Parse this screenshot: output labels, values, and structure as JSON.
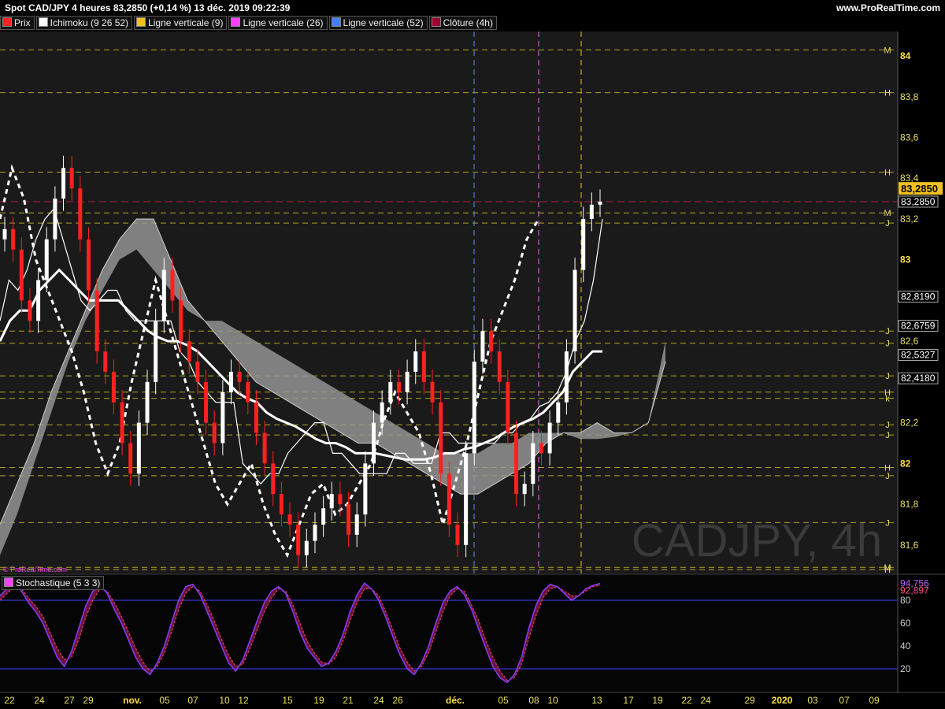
{
  "header": {
    "title": "Spot CAD/JPY 4 heures 83,2850 (+0,14 %) 13 déc. 2019 09:22:39",
    "site": "www.ProRealTime.com"
  },
  "legend": [
    {
      "label": "Prix",
      "color": "#ff2020"
    },
    {
      "label": "Ichimoku (9 26 52)",
      "color": "#ffffff"
    },
    {
      "label": "Ligne verticale (9)",
      "color": "#f0c020"
    },
    {
      "label": "Ligne verticale (26)",
      "color": "#ff40ff"
    },
    {
      "label": "Ligne verticale (52)",
      "color": "#4080ff"
    },
    {
      "label": "Clôture (4h)",
      "color": "#a00030"
    }
  ],
  "watermark": "CADJPY, 4h",
  "copyright": "© ProRealTime.com",
  "stoch_label": "Stochastique (5 3 3)",
  "colors": {
    "price_up": "#ffffff",
    "price_down": "#ff2020",
    "guide_yellow": "#c8c020",
    "stoch_k": "#8040ff",
    "stoch_d": "#ff4070",
    "stoch_band": "#4040ff",
    "current_price_bg": "#f0c020"
  },
  "chart_data": [
    {
      "type": "line",
      "x_ticks": [
        "22",
        "24",
        "27",
        "29",
        "nov.",
        "05",
        "07",
        "10",
        "12",
        "15",
        "19",
        "21",
        "24",
        "26",
        "déc.",
        "05",
        "08",
        "10",
        "13",
        "17",
        "19",
        "22",
        "24",
        "29",
        "2020",
        "03",
        "07",
        "09"
      ],
      "y_ticks": [
        "81,6",
        "81,8",
        "82",
        "82,2",
        "82,6",
        "83",
        "83,2",
        "83,4",
        "83,6",
        "83,8",
        "84"
      ],
      "ylim": [
        81.46,
        84.12
      ],
      "current_price": "83,2850",
      "value_labels": [
        {
          "text": "83,2850",
          "value": 83.285
        },
        {
          "text": "82,8190",
          "value": 82.819
        },
        {
          "text": "82,6759",
          "value": 82.676
        },
        {
          "text": "82,5327",
          "value": 82.533
        },
        {
          "text": "82,4180",
          "value": 82.418
        }
      ],
      "pivot_levels": [
        {
          "letter": "M",
          "value": 84.03
        },
        {
          "letter": "H",
          "value": 83.82
        },
        {
          "letter": "H",
          "value": 83.43
        },
        {
          "letter": "M",
          "value": 83.23
        },
        {
          "letter": "J",
          "value": 83.18
        },
        {
          "letter": "J",
          "value": 82.65
        },
        {
          "letter": "J",
          "value": 82.59
        },
        {
          "letter": "J",
          "value": 82.43
        },
        {
          "letter": "k",
          "value": 82.32
        },
        {
          "letter": "H",
          "value": 82.35
        },
        {
          "letter": "J",
          "value": 82.19
        },
        {
          "letter": "J",
          "value": 82.14
        },
        {
          "letter": "H",
          "value": 81.98
        },
        {
          "letter": "J",
          "value": 81.94
        },
        {
          "letter": "J",
          "value": 81.71
        },
        {
          "letter": "M",
          "value": 81.49
        },
        {
          "letter": "H",
          "value": 81.48
        }
      ],
      "series": [
        {
          "values": [
            83.15,
            83.05,
            82.8,
            82.7,
            82.9,
            83.1,
            83.3,
            83.45,
            83.35,
            83.1,
            82.85,
            82.55,
            82.45,
            82.3,
            82.1,
            81.95,
            82.2,
            82.4,
            82.7,
            82.95,
            82.8,
            82.6,
            82.5,
            82.4,
            82.2,
            82.1,
            82.35,
            82.45,
            82.4,
            82.3,
            82.15,
            82.0,
            81.85,
            81.75,
            81.7,
            81.55,
            81.62,
            81.7,
            81.78,
            81.85,
            81.8,
            81.65,
            81.75,
            82.0,
            82.2,
            82.3,
            82.4,
            82.35,
            82.45,
            82.55,
            82.4,
            82.3,
            81.95,
            81.7,
            81.6,
            82.05,
            82.5,
            82.65,
            82.55,
            82.4,
            82.15,
            81.85,
            81.9,
            82.1,
            82.05,
            82.2,
            82.3,
            82.55,
            82.95,
            83.2,
            83.27,
            83.285
          ]
        },
        {
          "values": [
            82.7,
            82.9,
            82.85,
            82.95,
            83.1,
            83.2,
            83.25,
            83.1,
            82.95,
            82.8,
            82.75,
            82.8,
            82.85,
            82.85,
            82.75,
            82.7,
            82.7,
            82.7,
            82.7,
            82.7,
            82.55,
            82.5,
            82.4,
            82.35,
            82.3,
            82.3,
            82.3,
            82.0,
            81.95,
            81.9,
            81.95,
            81.95,
            82.05,
            82.1,
            82.15,
            82.2,
            82.2,
            82.05,
            82.05,
            82.0,
            81.95,
            81.95,
            81.95,
            81.95,
            82.05,
            82.05,
            82.0,
            82.0,
            82.0,
            82.15,
            82.15,
            82.1,
            82.1,
            82.1,
            82.1,
            82.1,
            82.15,
            82.15,
            82.2,
            82.22,
            82.28,
            82.3,
            82.35,
            82.45,
            82.6,
            82.7,
            82.9,
            83.2
          ]
        },
        {
          "values": [
            82.6,
            82.7,
            82.75,
            82.75,
            82.85,
            82.9,
            82.95,
            82.9,
            82.85,
            82.8,
            82.8,
            82.8,
            82.8,
            82.75,
            82.7,
            82.65,
            82.62,
            82.6,
            82.6,
            82.58,
            82.55,
            82.5,
            82.45,
            82.4,
            82.35,
            82.32,
            82.3,
            82.25,
            82.22,
            82.2,
            82.18,
            82.15,
            82.12,
            82.1,
            82.1,
            82.08,
            82.05,
            82.05,
            82.05,
            82.04,
            82.03,
            82.02,
            82.02,
            82.02,
            82.03,
            82.05,
            82.05,
            82.07,
            82.08,
            82.1,
            82.12,
            82.15,
            82.18,
            82.2,
            82.22,
            82.25,
            82.3,
            82.35,
            82.45,
            82.5,
            82.55,
            82.55
          ]
        },
        {
          "values": [
            81.7,
            81.9,
            82.1,
            82.35,
            82.55,
            82.75,
            82.95,
            83.1,
            83.2,
            83.2,
            83.0,
            82.8,
            82.7,
            82.6,
            82.5,
            82.4,
            82.35,
            82.3,
            82.25,
            82.2,
            82.15,
            82.1,
            82.1,
            82.05,
            82.0,
            81.95,
            81.9,
            81.85,
            81.85,
            81.9,
            81.95,
            82.0,
            82.1,
            82.15,
            82.15,
            82.2,
            82.15,
            82.15,
            82.2,
            82.5
          ]
        },
        {
          "values": [
            81.55,
            81.75,
            82.0,
            82.25,
            82.5,
            82.7,
            82.85,
            83.0,
            83.05,
            82.95,
            82.85,
            82.75,
            82.7,
            82.7,
            82.65,
            82.6,
            82.55,
            82.5,
            82.45,
            82.4,
            82.35,
            82.3,
            82.25,
            82.2,
            82.15,
            82.1,
            82.05,
            82.05,
            82.05,
            82.1,
            82.1,
            82.15,
            82.15,
            82.15,
            82.12,
            82.12,
            82.13,
            82.15,
            82.2,
            82.6
          ]
        },
        {
          "values": [
            83.2,
            83.45,
            83.3,
            83.0,
            82.85,
            82.7,
            82.55,
            82.35,
            82.1,
            81.95,
            82.1,
            82.4,
            82.65,
            82.9,
            82.7,
            82.5,
            82.3,
            82.1,
            81.9,
            81.8,
            81.9,
            82.0,
            81.8,
            81.65,
            81.55,
            81.7,
            81.85,
            81.9,
            81.75,
            81.8,
            81.9,
            82.0,
            82.2,
            82.35,
            82.25,
            82.15,
            81.95,
            81.7,
            81.9,
            82.1,
            82.35,
            82.6,
            82.75,
            82.9,
            83.1,
            83.2
          ]
        },
        {
          "values": [
            84,
            90,
            96,
            88,
            78,
            70,
            60,
            45,
            30,
            22,
            35,
            55,
            75,
            88,
            93,
            86,
            72,
            60,
            45,
            30,
            20,
            15,
            25,
            40,
            60,
            80,
            92,
            94,
            85,
            70,
            55,
            40,
            25,
            18,
            28,
            45,
            62,
            78,
            88,
            92,
            86,
            70,
            52,
            38,
            30,
            22,
            25,
            35,
            50,
            70,
            85,
            95,
            90,
            80,
            65,
            48,
            32,
            20,
            15,
            25,
            40,
            60,
            78,
            88,
            92,
            85,
            72,
            55,
            38,
            22,
            12,
            8,
            15,
            30,
            55,
            75,
            88,
            94,
            92,
            86,
            80,
            84,
            90,
            93,
            94.76
          ]
        },
        {
          "values": [
            80,
            86,
            92,
            90,
            82,
            75,
            66,
            52,
            38,
            28,
            30,
            45,
            65,
            80,
            90,
            88,
            78,
            66,
            52,
            38,
            26,
            18,
            22,
            34,
            52,
            72,
            86,
            92,
            88,
            76,
            62,
            46,
            32,
            22,
            24,
            38,
            54,
            70,
            82,
            90,
            88,
            76,
            60,
            44,
            34,
            26,
            24,
            30,
            44,
            62,
            78,
            90,
            90,
            84,
            70,
            54,
            38,
            26,
            18,
            22,
            34,
            52,
            70,
            84,
            90,
            88,
            76,
            62,
            45,
            30,
            18,
            10,
            12,
            24,
            46,
            66,
            82,
            90,
            92,
            88,
            84,
            84,
            88,
            92,
            92.9
          ]
        }
      ]
    }
  ]
}
